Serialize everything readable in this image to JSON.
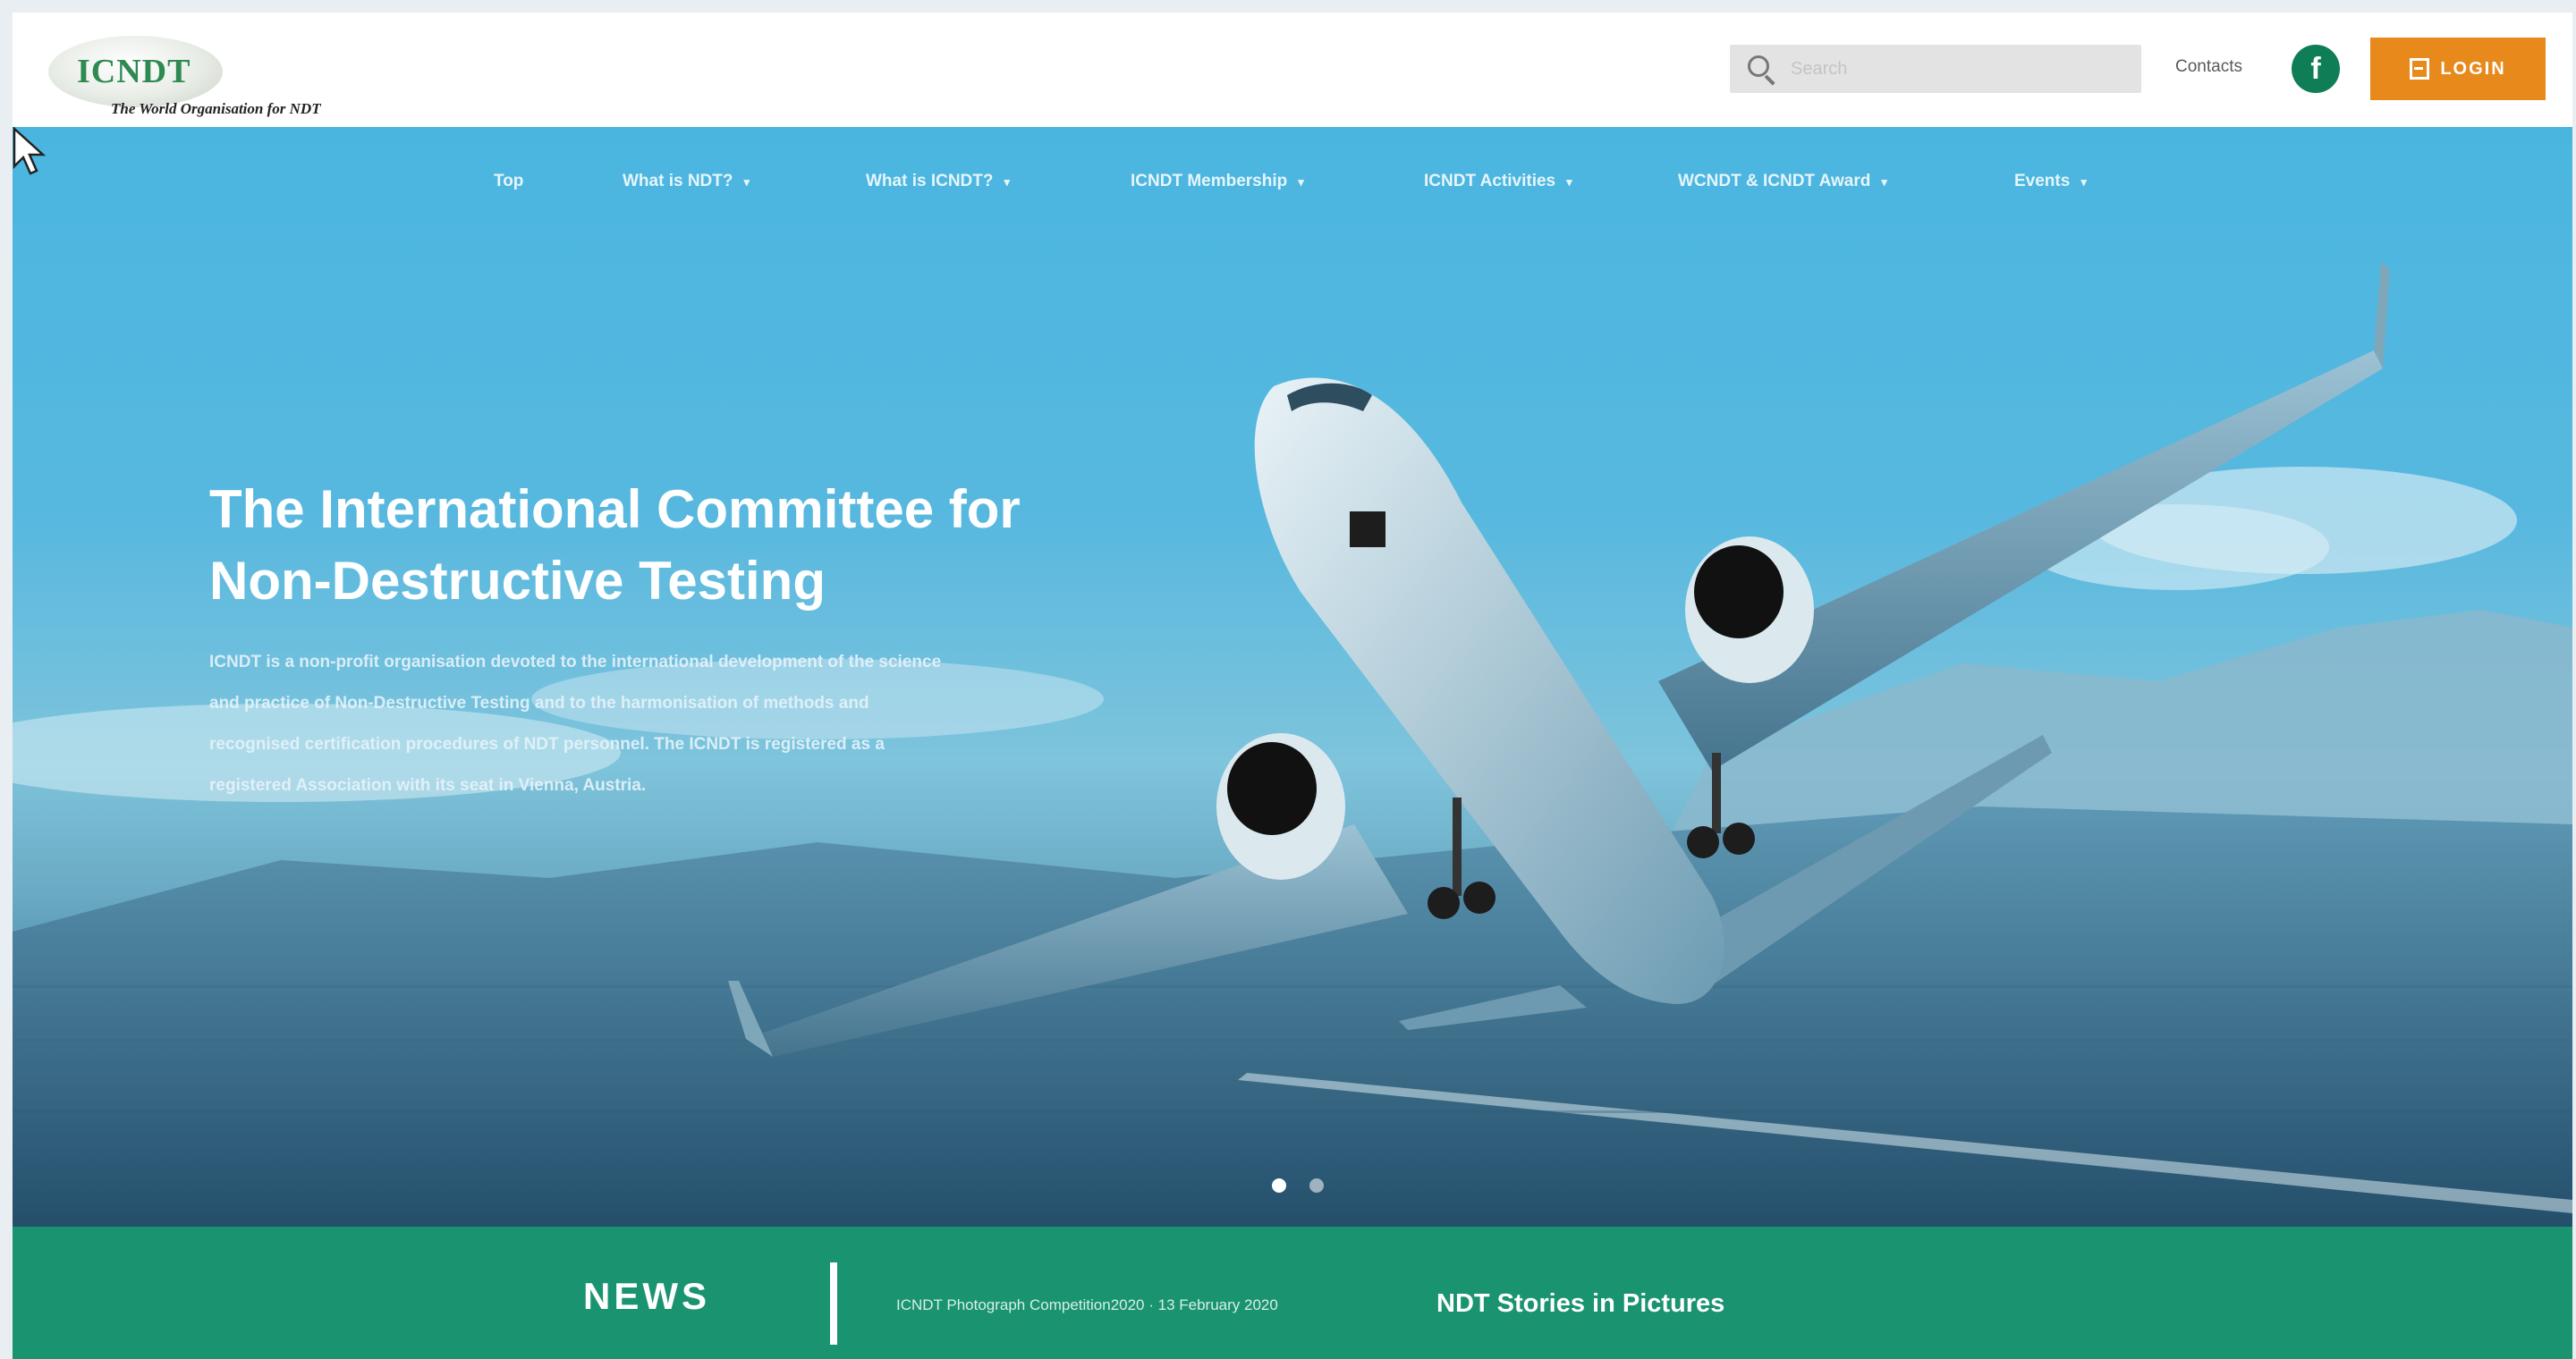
{
  "header": {
    "logo_text": "ICNDT",
    "logo_subtitle": "The World Organisation for NDT",
    "search_placeholder": "Search",
    "contacts_label": "Contacts",
    "facebook_glyph": "f",
    "login_label": "LOGIN"
  },
  "nav": {
    "items": [
      {
        "label": "Top",
        "has_dropdown": false
      },
      {
        "label": "What is NDT?",
        "has_dropdown": true
      },
      {
        "label": "What is ICNDT?",
        "has_dropdown": true
      },
      {
        "label": "ICNDT Membership",
        "has_dropdown": true
      },
      {
        "label": "ICNDT Activities",
        "has_dropdown": true
      },
      {
        "label": "WCNDT & ICNDT Award",
        "has_dropdown": true
      },
      {
        "label": "Events",
        "has_dropdown": true
      }
    ],
    "caret_glyph": "▾"
  },
  "hero": {
    "title_line1": "The International Committee for",
    "title_line2": "Non-Destructive Testing",
    "description": "ICNDT is a non-profit organisation devoted to the international development of the science and practice of Non-Destructive Testing and to the harmonisation of methods and recognised certification procedures of NDT personnel. The ICNDT is registered as a registered Association with its seat in Vienna, Austria.",
    "slide_count": 2,
    "active_slide": 1
  },
  "news": {
    "title": "NEWS",
    "item_date_text": "ICNDT Photograph Competition2020 · 13 February 2020",
    "item_headline": "NDT Stories in Pictures"
  },
  "colors": {
    "brand_green": "#1a9370",
    "login_orange": "#e7891b",
    "facebook_green": "#0f7d55",
    "sky_blue": "#4ab6e0"
  }
}
